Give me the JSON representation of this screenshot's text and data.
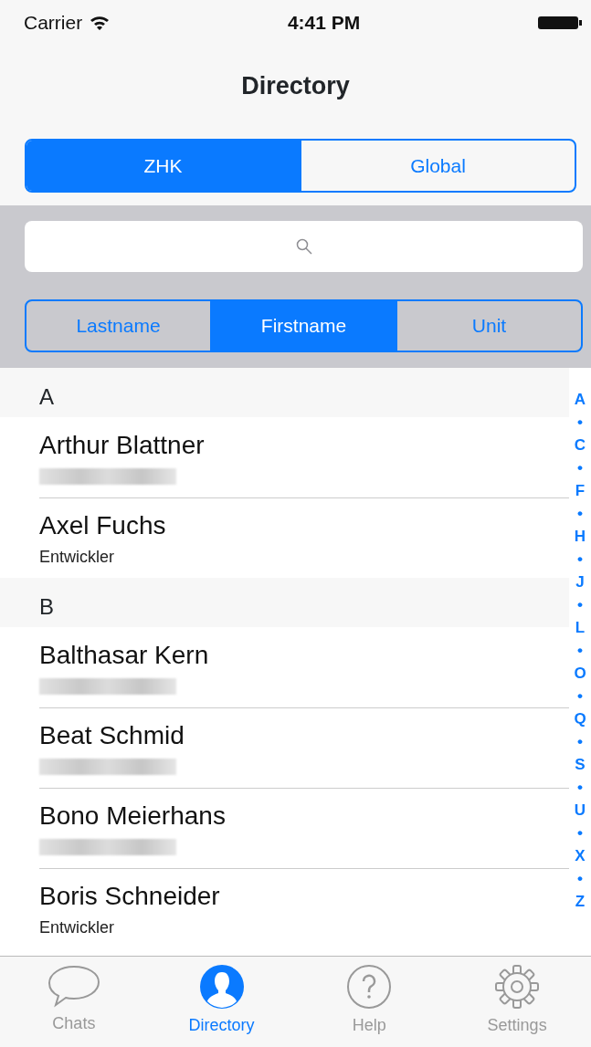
{
  "status_bar": {
    "carrier": "Carrier",
    "time": "4:41 PM"
  },
  "nav": {
    "title": "Directory"
  },
  "scope_tabs": [
    {
      "label": "ZHK",
      "selected": true
    },
    {
      "label": "Global",
      "selected": false
    }
  ],
  "sort_tabs": [
    {
      "label": "Lastname",
      "selected": false
    },
    {
      "label": "Firstname",
      "selected": true
    },
    {
      "label": "Unit",
      "selected": false
    }
  ],
  "sections": [
    {
      "letter": "A",
      "contacts": [
        {
          "name": "Arthur Blattner",
          "redacted": true
        },
        {
          "name": "Axel Fuchs",
          "subtitle": "Entwickler",
          "redacted": false
        }
      ]
    },
    {
      "letter": "B",
      "contacts": [
        {
          "name": "Balthasar Kern",
          "redacted": true
        },
        {
          "name": "Beat Schmid",
          "redacted": true
        },
        {
          "name": "Bono Meierhans",
          "redacted": true
        },
        {
          "name": "Boris Schneider",
          "subtitle": "Entwickler",
          "redacted": false
        }
      ]
    }
  ],
  "index": [
    "A",
    "•",
    "C",
    "•",
    "F",
    "•",
    "H",
    "•",
    "J",
    "•",
    "L",
    "•",
    "O",
    "•",
    "Q",
    "•",
    "S",
    "•",
    "U",
    "•",
    "X",
    "•",
    "Z"
  ],
  "tab_bar": [
    {
      "label": "Chats",
      "kind": "chat",
      "selected": false
    },
    {
      "label": "Directory",
      "kind": "person",
      "selected": true
    },
    {
      "label": "Help",
      "kind": "help",
      "selected": false
    },
    {
      "label": "Settings",
      "kind": "gear",
      "selected": false
    }
  ]
}
